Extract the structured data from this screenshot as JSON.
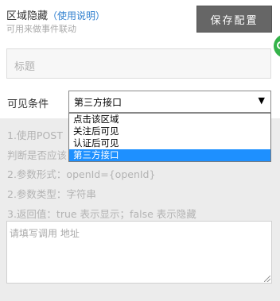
{
  "header": {
    "title": "区域隐藏",
    "help_link": "（使用说明）",
    "subtitle": "可用来做事件联动",
    "save_label": "保存配置"
  },
  "title_field": {
    "placeholder": "标题"
  },
  "visibility": {
    "label": "可见条件",
    "selected": "第三方接口",
    "options": [
      "点击该区域",
      "关注后可见",
      "认证后可见",
      "第三方接口"
    ],
    "selected_index": 3
  },
  "info": {
    "line1": "1.使用POST",
    "line2": "判断是否应该",
    "line3": "2.参数形式：openId={openId}",
    "line4": "2.参数类型：字符串",
    "line5": "3.返回值：true 表示显示；false 表示隐藏"
  },
  "url_field": {
    "placeholder": "请填写调用 地址"
  },
  "colors": {
    "selection": "#1e90ff",
    "save_button": "#666666",
    "link": "#2f7fcf"
  }
}
